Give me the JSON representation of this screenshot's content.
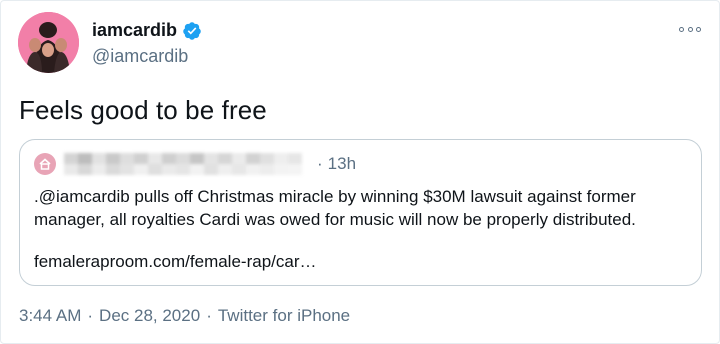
{
  "author": {
    "name": "iamcardib",
    "handle": "@iamcardib",
    "verified": true,
    "avatar_color": "#f27fa8",
    "verified_color": "#1da1f2"
  },
  "tweet": {
    "text": "Feels good to be free"
  },
  "quote": {
    "author_name_blurred": true,
    "time_sep": "·",
    "time": "13h",
    "text": ".@iamcardib pulls off Christmas miracle by winning $30M lawsuit against former manager, all royalties Cardi was owed for music will now be properly distributed.",
    "link": "femaleraproom.com/female-rap/car…",
    "avatar_icon": "house-icon"
  },
  "meta": {
    "time": "3:44 AM",
    "sep1": "·",
    "date": "Dec 28, 2020",
    "sep2": "·",
    "source": "Twitter for iPhone"
  },
  "icons": {
    "more": "more-options-icon",
    "verified": "verified-badge-icon"
  },
  "colors": {
    "text": "#0f1419",
    "secondary": "#5b7083",
    "border": "#c4cfd6"
  }
}
